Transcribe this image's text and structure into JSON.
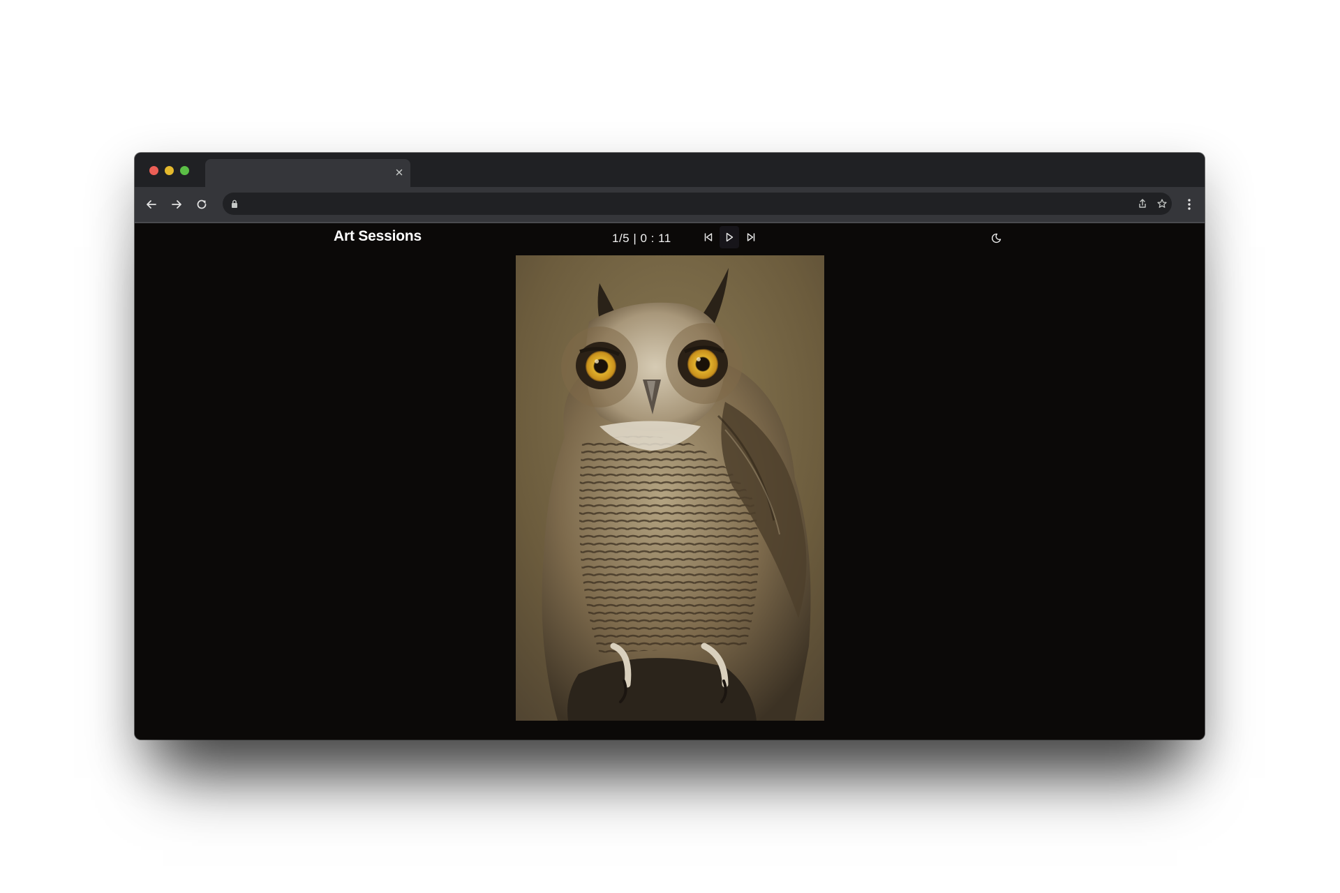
{
  "app": {
    "title": "Art Sessions",
    "counter": "1/5 | 0 : 11"
  },
  "browser": {
    "tab_title": "",
    "url": ""
  },
  "controls": {
    "previous": "skip-previous-icon",
    "play": "play-icon",
    "next": "skip-next-icon",
    "theme": "moon-icon"
  },
  "artwork": {
    "subject": "owl-photo"
  },
  "colors": {
    "page_bg": "#0b0908",
    "titlebar": "#202124",
    "toolbar": "#35363a",
    "text": "#ffffff"
  }
}
